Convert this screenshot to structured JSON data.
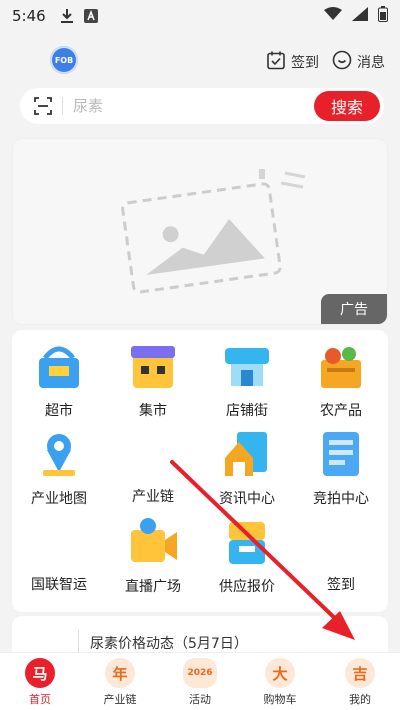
{
  "status_bar": {
    "time": "5:46"
  },
  "header": {
    "logo_text": "FOB",
    "signin_label": "签到",
    "messages_label": "消息"
  },
  "search": {
    "placeholder": "尿素",
    "button_label": "搜索"
  },
  "banner": {
    "ad_label": "广告"
  },
  "grid": {
    "items": [
      {
        "label": "超市",
        "icon": "supermarket-icon"
      },
      {
        "label": "集市",
        "icon": "market-icon"
      },
      {
        "label": "店铺街",
        "icon": "shop-street-icon"
      },
      {
        "label": "农产品",
        "icon": "farm-products-icon"
      },
      {
        "label": "产业地图",
        "icon": "industry-map-icon"
      },
      {
        "label": "产业链",
        "icon": "industry-chain-icon"
      },
      {
        "label": "资讯中心",
        "icon": "news-center-icon"
      },
      {
        "label": "竞拍中心",
        "icon": "auction-center-icon"
      },
      {
        "label": "国联智运",
        "icon": "logistics-icon"
      },
      {
        "label": "直播广场",
        "icon": "live-plaza-icon"
      },
      {
        "label": "供应报价",
        "icon": "supply-quote-icon"
      },
      {
        "label": "签到",
        "icon": "signin-icon"
      }
    ]
  },
  "news": {
    "text": "尿素价格动态（5月7日）"
  },
  "bottom_nav": {
    "items": [
      {
        "label": "首页",
        "icon_text": "马"
      },
      {
        "label": "产业链",
        "icon_text": "年"
      },
      {
        "label": "活动",
        "icon_text": "2026"
      },
      {
        "label": "购物车",
        "icon_text": "大"
      },
      {
        "label": "我的",
        "icon_text": "吉"
      }
    ]
  },
  "colors": {
    "accent": "#e8202a",
    "nav_icon_bg": "#fde7d6",
    "nav_icon_fg": "#e86a1a"
  }
}
